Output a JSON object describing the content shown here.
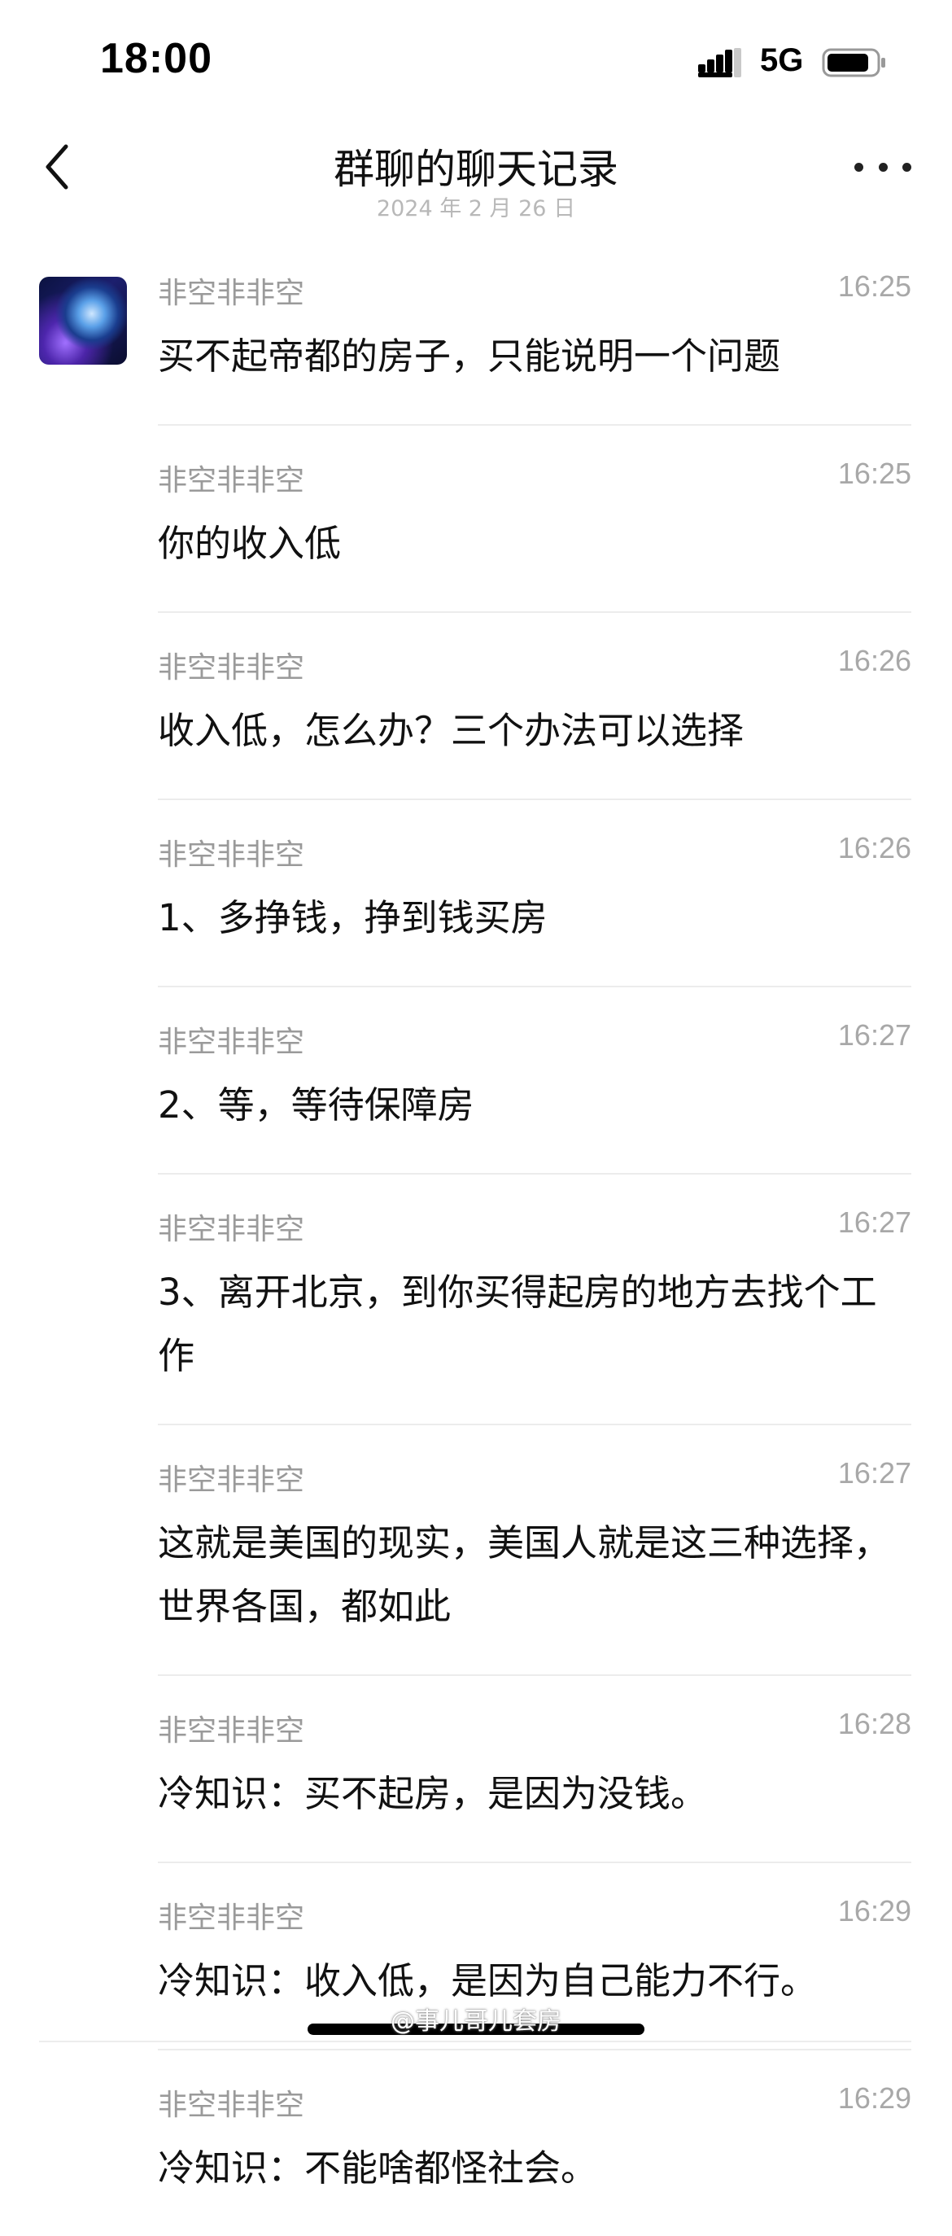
{
  "status_bar": {
    "time": "18:00",
    "network": "5G"
  },
  "header": {
    "title": "群聊的聊天记录",
    "subtitle": "2024 年 2 月 26 日"
  },
  "messages": [
    {
      "sender": "非空非非空",
      "time": "16:25",
      "text": "买不起帝都的房子，只能说明一个问题"
    },
    {
      "sender": "非空非非空",
      "time": "16:25",
      "text": "你的收入低"
    },
    {
      "sender": "非空非非空",
      "time": "16:26",
      "text": "收入低，怎么办？三个办法可以选择"
    },
    {
      "sender": "非空非非空",
      "time": "16:26",
      "text": "1、多挣钱，挣到钱买房"
    },
    {
      "sender": "非空非非空",
      "time": "16:27",
      "text": "2、等，等待保障房"
    },
    {
      "sender": "非空非非空",
      "time": "16:27",
      "text": "3、离开北京，到你买得起房的地方去找个工作"
    },
    {
      "sender": "非空非非空",
      "time": "16:27",
      "text": "这就是美国的现实，美国人就是这三种选择，世界各国，都如此"
    },
    {
      "sender": "非空非非空",
      "time": "16:28",
      "text": "冷知识：买不起房，是因为没钱。"
    },
    {
      "sender": "非空非非空",
      "time": "16:29",
      "text": "冷知识：收入低，是因为自己能力不行。"
    },
    {
      "sender": "非空非非空",
      "time": "16:29",
      "text": "冷知识：不能啥都怪社会。"
    }
  ],
  "watermark": "@事儿哥儿套房"
}
